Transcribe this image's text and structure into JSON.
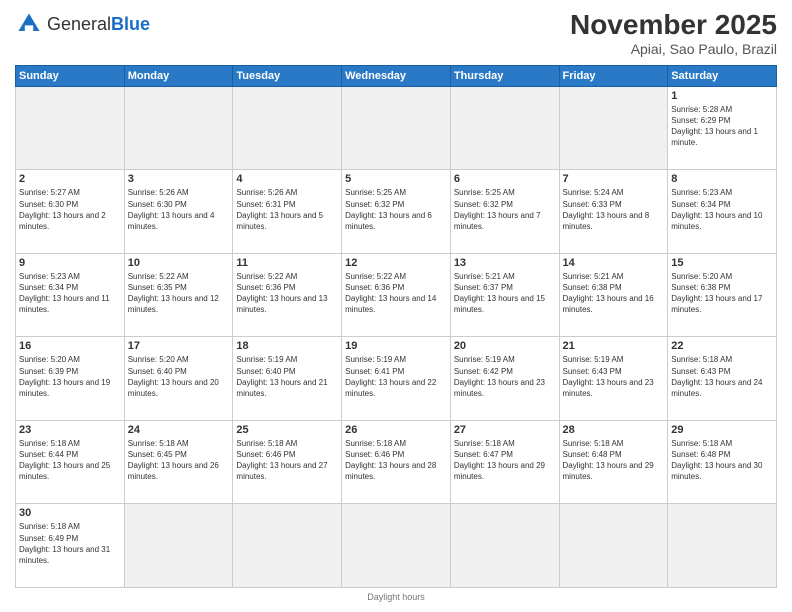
{
  "header": {
    "logo_general": "General",
    "logo_blue": "Blue",
    "month_title": "November 2025",
    "location": "Apiai, Sao Paulo, Brazil"
  },
  "days_of_week": [
    "Sunday",
    "Monday",
    "Tuesday",
    "Wednesday",
    "Thursday",
    "Friday",
    "Saturday"
  ],
  "weeks": [
    [
      {
        "num": "",
        "empty": true
      },
      {
        "num": "",
        "empty": true
      },
      {
        "num": "",
        "empty": true
      },
      {
        "num": "",
        "empty": true
      },
      {
        "num": "",
        "empty": true
      },
      {
        "num": "",
        "empty": true
      },
      {
        "num": "1",
        "sunrise": "5:28 AM",
        "sunset": "6:29 PM",
        "daylight": "13 hours and 1 minute."
      }
    ],
    [
      {
        "num": "2",
        "sunrise": "5:27 AM",
        "sunset": "6:30 PM",
        "daylight": "13 hours and 2 minutes."
      },
      {
        "num": "3",
        "sunrise": "5:26 AM",
        "sunset": "6:30 PM",
        "daylight": "13 hours and 4 minutes."
      },
      {
        "num": "4",
        "sunrise": "5:26 AM",
        "sunset": "6:31 PM",
        "daylight": "13 hours and 5 minutes."
      },
      {
        "num": "5",
        "sunrise": "5:25 AM",
        "sunset": "6:32 PM",
        "daylight": "13 hours and 6 minutes."
      },
      {
        "num": "6",
        "sunrise": "5:25 AM",
        "sunset": "6:32 PM",
        "daylight": "13 hours and 7 minutes."
      },
      {
        "num": "7",
        "sunrise": "5:24 AM",
        "sunset": "6:33 PM",
        "daylight": "13 hours and 8 minutes."
      },
      {
        "num": "8",
        "sunrise": "5:23 AM",
        "sunset": "6:34 PM",
        "daylight": "13 hours and 10 minutes."
      }
    ],
    [
      {
        "num": "9",
        "sunrise": "5:23 AM",
        "sunset": "6:34 PM",
        "daylight": "13 hours and 11 minutes."
      },
      {
        "num": "10",
        "sunrise": "5:22 AM",
        "sunset": "6:35 PM",
        "daylight": "13 hours and 12 minutes."
      },
      {
        "num": "11",
        "sunrise": "5:22 AM",
        "sunset": "6:36 PM",
        "daylight": "13 hours and 13 minutes."
      },
      {
        "num": "12",
        "sunrise": "5:22 AM",
        "sunset": "6:36 PM",
        "daylight": "13 hours and 14 minutes."
      },
      {
        "num": "13",
        "sunrise": "5:21 AM",
        "sunset": "6:37 PM",
        "daylight": "13 hours and 15 minutes."
      },
      {
        "num": "14",
        "sunrise": "5:21 AM",
        "sunset": "6:38 PM",
        "daylight": "13 hours and 16 minutes."
      },
      {
        "num": "15",
        "sunrise": "5:20 AM",
        "sunset": "6:38 PM",
        "daylight": "13 hours and 17 minutes."
      }
    ],
    [
      {
        "num": "16",
        "sunrise": "5:20 AM",
        "sunset": "6:39 PM",
        "daylight": "13 hours and 19 minutes."
      },
      {
        "num": "17",
        "sunrise": "5:20 AM",
        "sunset": "6:40 PM",
        "daylight": "13 hours and 20 minutes."
      },
      {
        "num": "18",
        "sunrise": "5:19 AM",
        "sunset": "6:40 PM",
        "daylight": "13 hours and 21 minutes."
      },
      {
        "num": "19",
        "sunrise": "5:19 AM",
        "sunset": "6:41 PM",
        "daylight": "13 hours and 22 minutes."
      },
      {
        "num": "20",
        "sunrise": "5:19 AM",
        "sunset": "6:42 PM",
        "daylight": "13 hours and 23 minutes."
      },
      {
        "num": "21",
        "sunrise": "5:19 AM",
        "sunset": "6:43 PM",
        "daylight": "13 hours and 23 minutes."
      },
      {
        "num": "22",
        "sunrise": "5:18 AM",
        "sunset": "6:43 PM",
        "daylight": "13 hours and 24 minutes."
      }
    ],
    [
      {
        "num": "23",
        "sunrise": "5:18 AM",
        "sunset": "6:44 PM",
        "daylight": "13 hours and 25 minutes."
      },
      {
        "num": "24",
        "sunrise": "5:18 AM",
        "sunset": "6:45 PM",
        "daylight": "13 hours and 26 minutes."
      },
      {
        "num": "25",
        "sunrise": "5:18 AM",
        "sunset": "6:46 PM",
        "daylight": "13 hours and 27 minutes."
      },
      {
        "num": "26",
        "sunrise": "5:18 AM",
        "sunset": "6:46 PM",
        "daylight": "13 hours and 28 minutes."
      },
      {
        "num": "27",
        "sunrise": "5:18 AM",
        "sunset": "6:47 PM",
        "daylight": "13 hours and 29 minutes."
      },
      {
        "num": "28",
        "sunrise": "5:18 AM",
        "sunset": "6:48 PM",
        "daylight": "13 hours and 29 minutes."
      },
      {
        "num": "29",
        "sunrise": "5:18 AM",
        "sunset": "6:48 PM",
        "daylight": "13 hours and 30 minutes."
      }
    ],
    [
      {
        "num": "30",
        "sunrise": "5:18 AM",
        "sunset": "6:49 PM",
        "daylight": "13 hours and 31 minutes."
      },
      {
        "num": "",
        "empty": true
      },
      {
        "num": "",
        "empty": true
      },
      {
        "num": "",
        "empty": true
      },
      {
        "num": "",
        "empty": true
      },
      {
        "num": "",
        "empty": true
      },
      {
        "num": "",
        "empty": true
      }
    ]
  ],
  "footer": {
    "daylight_label": "Daylight hours"
  }
}
